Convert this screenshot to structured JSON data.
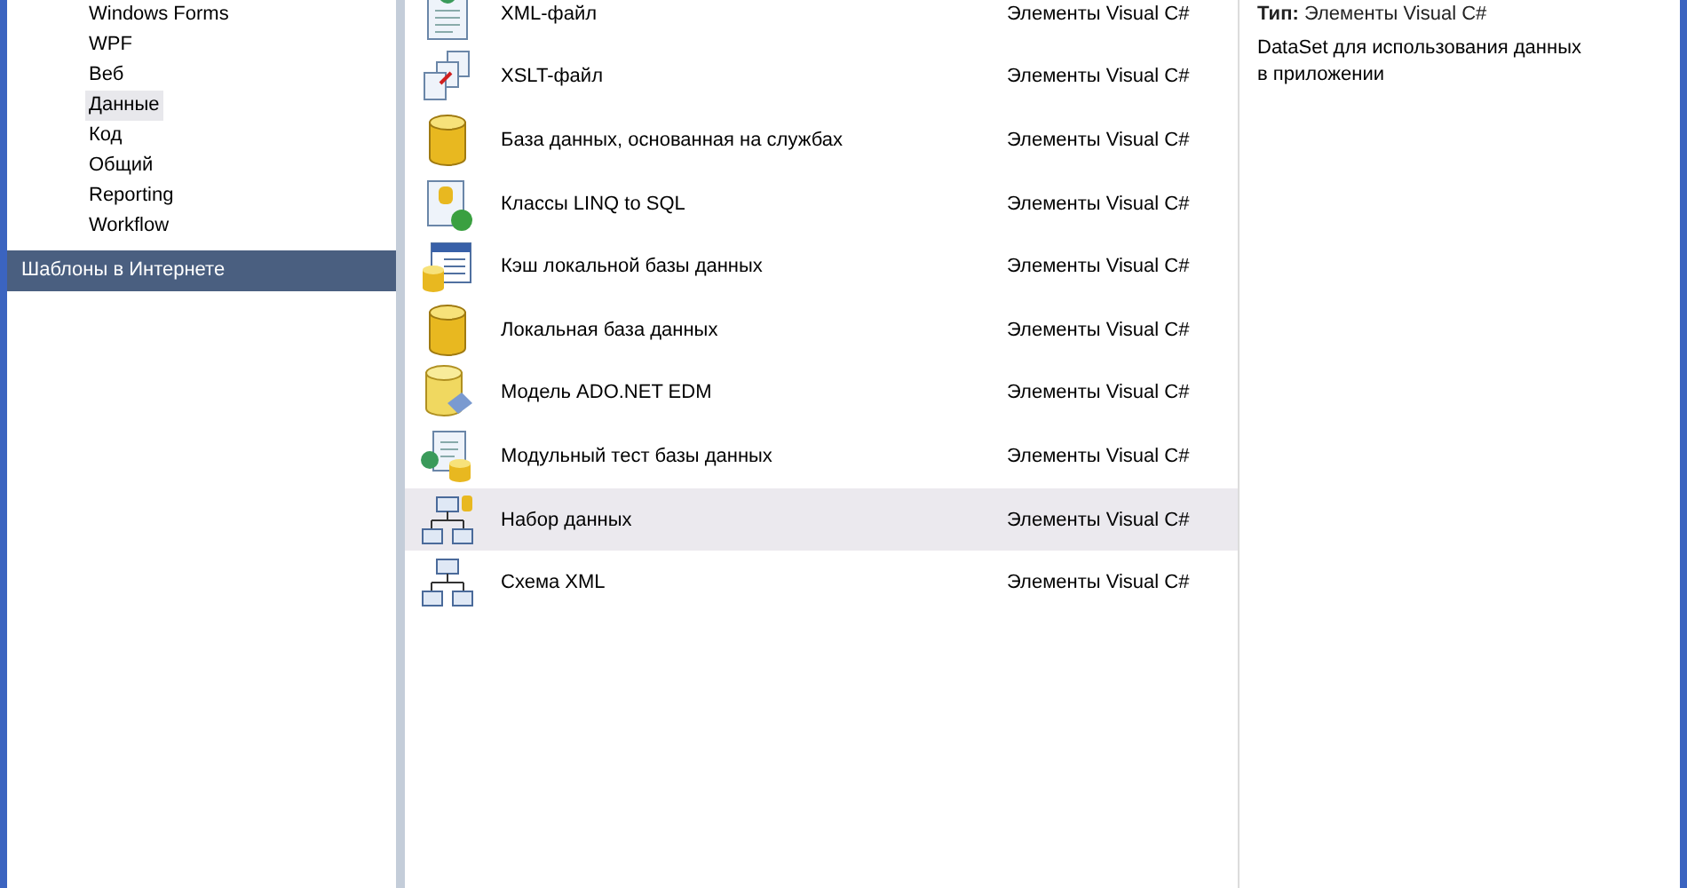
{
  "categories": [
    {
      "label": "Windows Forms",
      "selected": false
    },
    {
      "label": "WPF",
      "selected": false
    },
    {
      "label": "Веб",
      "selected": false
    },
    {
      "label": "Данные",
      "selected": true
    },
    {
      "label": "Код",
      "selected": false
    },
    {
      "label": "Общий",
      "selected": false
    },
    {
      "label": "Reporting",
      "selected": false
    },
    {
      "label": "Workflow",
      "selected": false
    }
  ],
  "online_templates": {
    "label": "Шаблоны в Интернете"
  },
  "templates": [
    {
      "kind": "xml",
      "name": "XML-файл",
      "type": "Элементы Visual C#",
      "selected": false
    },
    {
      "kind": "xslt",
      "name": "XSLT-файл",
      "type": "Элементы Visual C#",
      "selected": false
    },
    {
      "kind": "database",
      "name": "База данных, основанная на службах",
      "type": "Элементы Visual C#",
      "selected": false
    },
    {
      "kind": "linq",
      "name": "Классы LINQ to SQL",
      "type": "Элементы Visual C#",
      "selected": false
    },
    {
      "kind": "cache",
      "name": "Кэш локальной базы данных",
      "type": "Элементы Visual C#",
      "selected": false
    },
    {
      "kind": "database",
      "name": "Локальная база данных",
      "type": "Элементы Visual C#",
      "selected": false
    },
    {
      "kind": "edm",
      "name": "Модель ADO.NET EDM",
      "type": "Элементы Visual C#",
      "selected": false
    },
    {
      "kind": "test",
      "name": "Модульный тест базы данных",
      "type": "Элементы Visual C#",
      "selected": false
    },
    {
      "kind": "dataset",
      "name": "Набор данных",
      "type": "Элементы Visual C#",
      "selected": true
    },
    {
      "kind": "schema",
      "name": "Схема XML",
      "type": "Элементы Visual C#",
      "selected": false
    }
  ],
  "details": {
    "type_label": "Тип:",
    "type_value": "Элементы Visual C#",
    "description": "DataSet для использования данных в приложении"
  }
}
